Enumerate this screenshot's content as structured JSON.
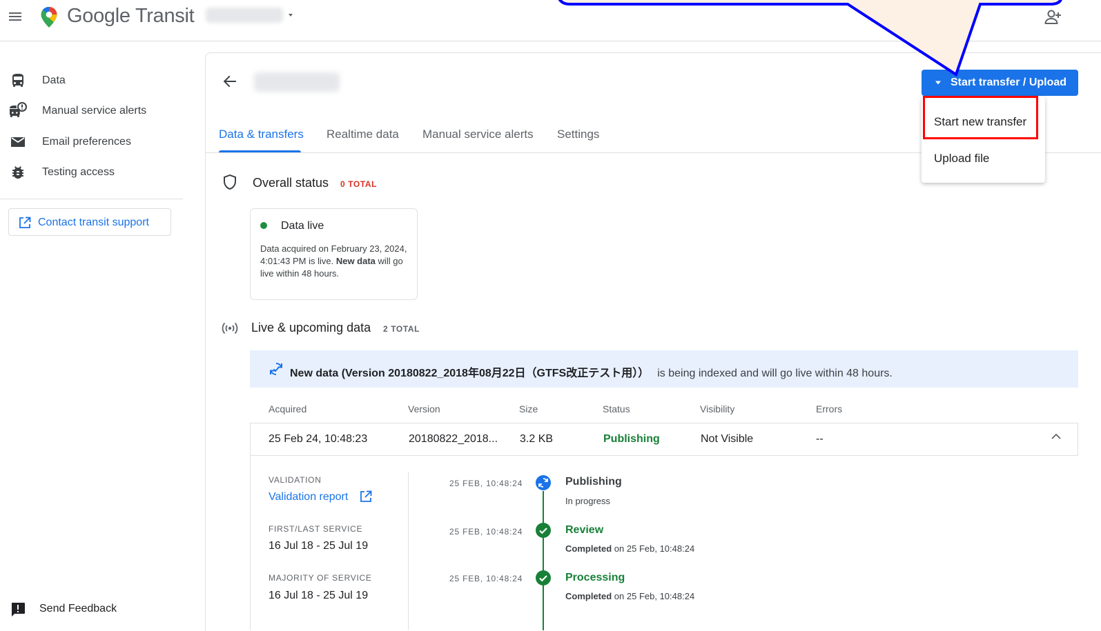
{
  "header": {
    "app_name": "Google Transit",
    "menu_icon": "hamburger-menu-icon",
    "logo_icon": "google-maps-pin-icon",
    "account_icon": "add-person-icon"
  },
  "sidebar": {
    "items": [
      {
        "label": "Data",
        "icon": "bus-icon"
      },
      {
        "label": "Manual service alerts",
        "icon": "bus-alert-icon"
      },
      {
        "label": "Email preferences",
        "icon": "mail-icon"
      },
      {
        "label": "Testing access",
        "icon": "bug-icon"
      }
    ],
    "contact_label": "Contact transit support",
    "feedback_label": "Send Feedback"
  },
  "main": {
    "tabs": [
      {
        "label": "Data & transfers",
        "active": true
      },
      {
        "label": "Realtime data",
        "active": false
      },
      {
        "label": "Manual service alerts",
        "active": false
      },
      {
        "label": "Settings",
        "active": false
      }
    ],
    "action_button": "Start transfer / Upload",
    "action_menu": [
      "Start new transfer",
      "Upload file"
    ],
    "overall": {
      "title": "Overall status",
      "badge": "0 TOTAL",
      "badge_color": "#d93025",
      "card_status": "Data live",
      "card_desc_1": "Data acquired on February 23, 2024, 4:01:43 PM is live.",
      "card_desc_bold": "New data",
      "card_desc_2": "will go live within 48 hours."
    },
    "live": {
      "title": "Live & upcoming data",
      "badge": "2 TOTAL",
      "banner_bold": "New data (Version 20180822_2018年08月22日（GTFS改正テスト用））",
      "banner_rest": "is being indexed and will go live within 48 hours.",
      "columns": [
        "Acquired",
        "Version",
        "Size",
        "Status",
        "Visibility",
        "Errors"
      ],
      "row": {
        "acquired": "25 Feb 24, 10:48:23",
        "version": "20180822_2018...",
        "size": "3.2 KB",
        "status": "Publishing",
        "visibility": "Not Visible",
        "errors": "--"
      },
      "details": {
        "validation_label": "VALIDATION",
        "validation_link": "Validation report",
        "first_last_label": "FIRST/LAST SERVICE",
        "first_last_value": "16 Jul 18 - 25 Jul 19",
        "majority_label": "MAJORITY OF SERVICE",
        "majority_value": "16 Jul 18 - 25 Jul 19"
      },
      "timeline": [
        {
          "time": "25 FEB, 10:48:24",
          "title": "Publishing",
          "sub_bold": "",
          "sub": "In progress"
        },
        {
          "time": "25 FEB, 10:48:24",
          "title": "Review",
          "sub_bold": "Completed",
          "sub": "on 25 Feb, 10:48:24"
        },
        {
          "time": "25 FEB, 10:48:24",
          "title": "Processing",
          "sub_bold": "Completed",
          "sub": "on 25 Feb, 10:48:24"
        }
      ]
    }
  },
  "colors": {
    "accent": "#1a73e8",
    "success": "#188038",
    "banner_bg": "#e8f0fe",
    "highlight": "#ff0000",
    "callout_stroke": "#0000ff",
    "callout_fill": "#fdf1e6"
  }
}
